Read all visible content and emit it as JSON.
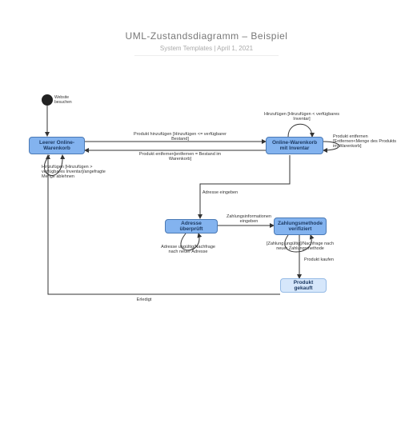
{
  "header": {
    "title": "UML-Zustandsdiagramm – Beispiel",
    "subtitle": "System Templates  |  April 1, 2021"
  },
  "states": {
    "initial_label": "Website\nbesuchen",
    "empty_cart": "Leerer\nOnline-Warenkorb",
    "cart_with_inventory": "Online-Warenkorb\nmit Inventar",
    "address_checked": "Adresse überprüft",
    "payment_verified": "Zahlungsmethode\nverifiziert",
    "product_bought": "Produkt gekauft"
  },
  "transitions": {
    "add_product_forward": "Produkt hinzufügen [Hinzufügen <= verfügbarer\nBestand]",
    "remove_product_back": "Produkt entfernen[entfernen = Bestand im\nWarenkorb]",
    "add_self_loop_cart": "Hinzufügen [Hinzufügen < verfügbares\nInventar]",
    "remove_self_loop_cart": "Produkt entfernen\n[Entfernen<Menge\ndes Produkts im Warenkorb]",
    "add_overflow": "Hinzufügen [Hinzufügen >\nverfügbares\nInventar]/angefragte Menge\nablehnen",
    "enter_address": "Adresse\neingeben",
    "enter_payment": "Zahlungsinformationen\neingeben",
    "address_invalid": "Adresse\nungültig/Nachfrage\nnach neuer Adresse",
    "payment_invalid": "[Zahlung ungültig]/Nachfrage\nnach\nneuer Zahlungsmethode",
    "buy_product": "Produkt\nkaufen",
    "finished": "Erledigt"
  }
}
